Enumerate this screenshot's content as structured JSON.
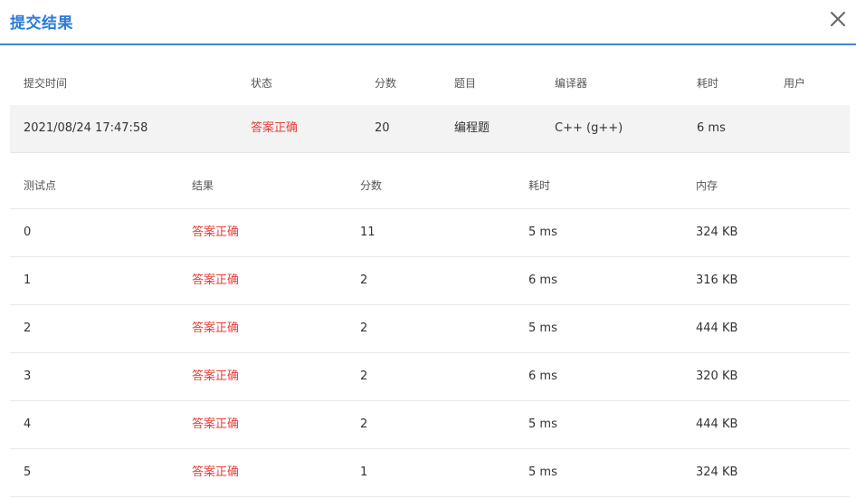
{
  "dialog": {
    "title": "提交结果"
  },
  "summary": {
    "headers": {
      "submit_time": "提交时间",
      "status": "状态",
      "score": "分数",
      "problem": "题目",
      "compiler": "编译器",
      "time": "耗时",
      "user": "用户"
    },
    "row": {
      "submit_time": "2021/08/24 17:47:58",
      "status": "答案正确",
      "score": "20",
      "problem": "编程题",
      "compiler": "C++ (g++)",
      "time": "6 ms",
      "user": ""
    }
  },
  "tests": {
    "headers": {
      "case": "测试点",
      "result": "结果",
      "score": "分数",
      "time": "耗时",
      "memory": "内存"
    },
    "rows": [
      {
        "case": "0",
        "result": "答案正确",
        "score": "11",
        "time": "5 ms",
        "memory": "324 KB"
      },
      {
        "case": "1",
        "result": "答案正确",
        "score": "2",
        "time": "6 ms",
        "memory": "316 KB"
      },
      {
        "case": "2",
        "result": "答案正确",
        "score": "2",
        "time": "5 ms",
        "memory": "444 KB"
      },
      {
        "case": "3",
        "result": "答案正确",
        "score": "2",
        "time": "6 ms",
        "memory": "320 KB"
      },
      {
        "case": "4",
        "result": "答案正确",
        "score": "2",
        "time": "5 ms",
        "memory": "444 KB"
      },
      {
        "case": "5",
        "result": "答案正确",
        "score": "1",
        "time": "5 ms",
        "memory": "324 KB"
      }
    ]
  },
  "colors": {
    "accent": "#2b7bd8",
    "accepted": "#e5413a"
  },
  "icons": {
    "close": "close-icon"
  }
}
